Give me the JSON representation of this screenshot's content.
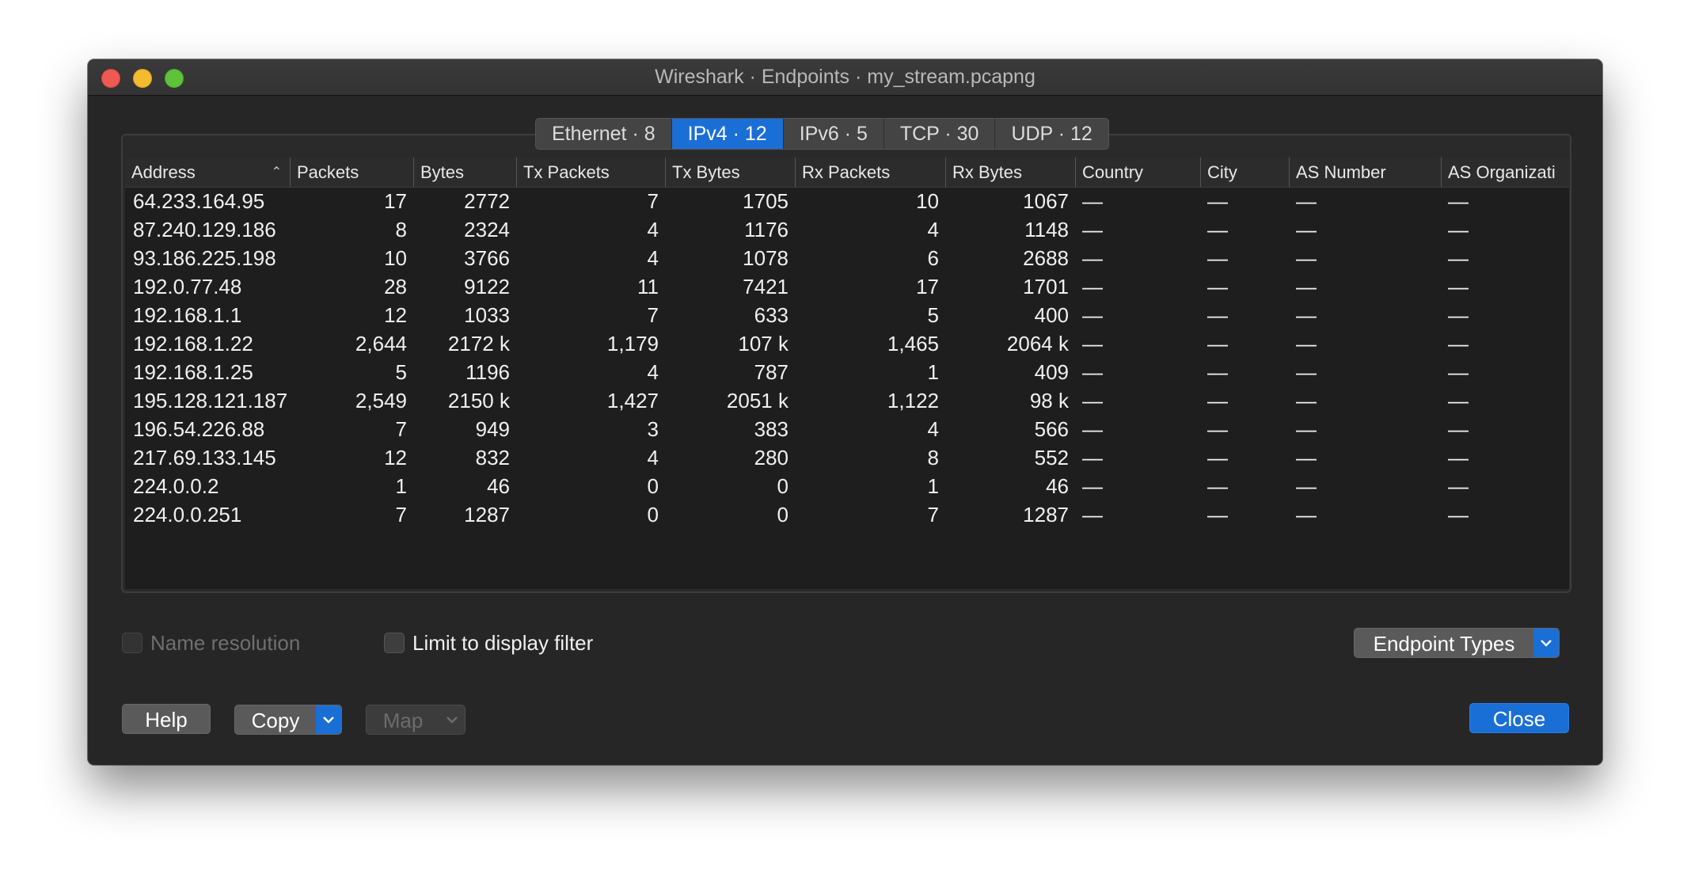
{
  "window": {
    "title": "Wireshark · Endpoints · my_stream.pcapng"
  },
  "tabs": [
    {
      "label": "Ethernet · 8",
      "active": false
    },
    {
      "label": "IPv4 · 12",
      "active": true
    },
    {
      "label": "IPv6 · 5",
      "active": false
    },
    {
      "label": "TCP · 30",
      "active": false
    },
    {
      "label": "UDP · 12",
      "active": false
    }
  ],
  "table": {
    "columns": [
      "Address",
      "Packets",
      "Bytes",
      "Tx Packets",
      "Tx Bytes",
      "Rx Packets",
      "Rx Bytes",
      "Country",
      "City",
      "AS Number",
      "AS Organizati"
    ],
    "rows": [
      [
        "64.233.164.95",
        "17",
        "2772",
        "7",
        "1705",
        "10",
        "1067",
        "—",
        "—",
        "—",
        "—"
      ],
      [
        "87.240.129.186",
        "8",
        "2324",
        "4",
        "1176",
        "4",
        "1148",
        "—",
        "—",
        "—",
        "—"
      ],
      [
        "93.186.225.198",
        "10",
        "3766",
        "4",
        "1078",
        "6",
        "2688",
        "—",
        "—",
        "—",
        "—"
      ],
      [
        "192.0.77.48",
        "28",
        "9122",
        "11",
        "7421",
        "17",
        "1701",
        "—",
        "—",
        "—",
        "—"
      ],
      [
        "192.168.1.1",
        "12",
        "1033",
        "7",
        "633",
        "5",
        "400",
        "—",
        "—",
        "—",
        "—"
      ],
      [
        "192.168.1.22",
        "2,644",
        "2172 k",
        "1,179",
        "107 k",
        "1,465",
        "2064 k",
        "—",
        "—",
        "—",
        "—"
      ],
      [
        "192.168.1.25",
        "5",
        "1196",
        "4",
        "787",
        "1",
        "409",
        "—",
        "—",
        "—",
        "—"
      ],
      [
        "195.128.121.187",
        "2,549",
        "2150 k",
        "1,427",
        "2051 k",
        "1,122",
        "98 k",
        "—",
        "—",
        "—",
        "—"
      ],
      [
        "196.54.226.88",
        "7",
        "949",
        "3",
        "383",
        "4",
        "566",
        "—",
        "—",
        "—",
        "—"
      ],
      [
        "217.69.133.145",
        "12",
        "832",
        "4",
        "280",
        "8",
        "552",
        "—",
        "—",
        "—",
        "—"
      ],
      [
        "224.0.0.2",
        "1",
        "46",
        "0",
        "0",
        "1",
        "46",
        "—",
        "—",
        "—",
        "—"
      ],
      [
        "224.0.0.251",
        "7",
        "1287",
        "0",
        "0",
        "7",
        "1287",
        "—",
        "—",
        "—",
        "—"
      ]
    ]
  },
  "options": {
    "name_resolution_label": "Name resolution",
    "limit_filter_label": "Limit to display filter"
  },
  "buttons": {
    "endpoint_types": "Endpoint Types",
    "help": "Help",
    "copy": "Copy",
    "map": "Map",
    "close": "Close"
  },
  "colors": {
    "accent": "#1a6fd6",
    "window_bg": "#262626"
  }
}
